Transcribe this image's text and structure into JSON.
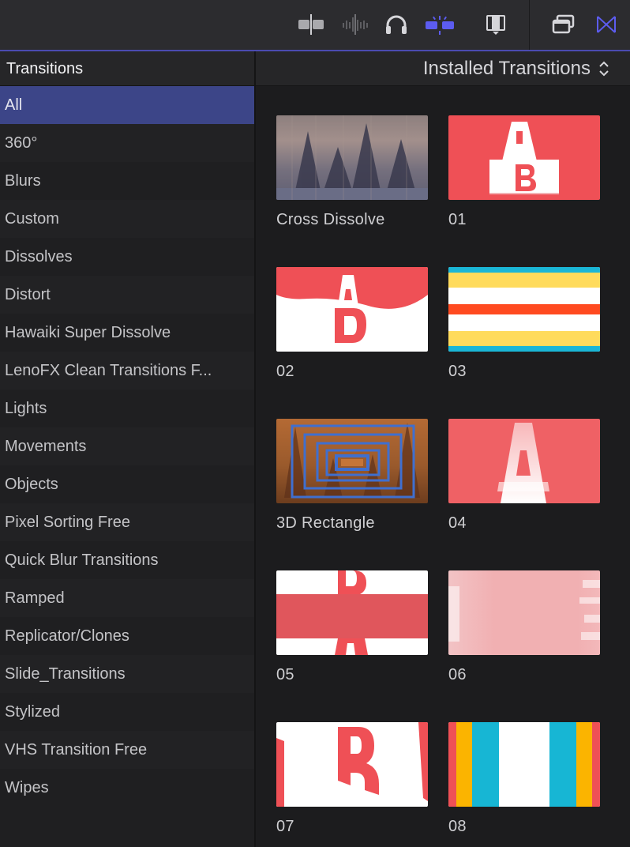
{
  "toolbar": {
    "icons": [
      "clip-skimming-icon",
      "audio-skimming-icon",
      "headphones-solo-icon",
      "snapping-icon",
      "video-browser-icon",
      "window-layout-icon",
      "transitions-browser-icon"
    ],
    "accent_color": "#5c5cf0"
  },
  "sidebar": {
    "title": "Transitions",
    "items": [
      {
        "label": "All",
        "selected": true
      },
      {
        "label": "360°"
      },
      {
        "label": "Blurs"
      },
      {
        "label": "Custom"
      },
      {
        "label": "Dissolves"
      },
      {
        "label": "Distort"
      },
      {
        "label": "Hawaiki Super Dissolve"
      },
      {
        "label": "LenoFX Clean Transitions F..."
      },
      {
        "label": "Lights"
      },
      {
        "label": "Movements"
      },
      {
        "label": "Objects"
      },
      {
        "label": "Pixel Sorting Free"
      },
      {
        "label": "Quick Blur Transitions"
      },
      {
        "label": "Ramped"
      },
      {
        "label": "Replicator/Clones"
      },
      {
        "label": "Slide_Transitions"
      },
      {
        "label": "Stylized"
      },
      {
        "label": "VHS Transition Free"
      },
      {
        "label": "Wipes"
      }
    ]
  },
  "main": {
    "dropdown_label": "Installed Transitions",
    "tiles": [
      {
        "label": "Cross Dissolve",
        "thumb": "cross-dissolve-thumbnail"
      },
      {
        "label": "01",
        "thumb": "transition-01-thumbnail"
      },
      {
        "label": "02",
        "thumb": "transition-02-thumbnail"
      },
      {
        "label": "03",
        "thumb": "transition-03-thumbnail"
      },
      {
        "label": "3D Rectangle",
        "thumb": "3d-rectangle-thumbnail"
      },
      {
        "label": "04",
        "thumb": "transition-04-thumbnail"
      },
      {
        "label": "05",
        "thumb": "transition-05-thumbnail"
      },
      {
        "label": "06",
        "thumb": "transition-06-thumbnail"
      },
      {
        "label": "07",
        "thumb": "transition-07-thumbnail"
      },
      {
        "label": "08",
        "thumb": "transition-08-thumbnail"
      }
    ]
  }
}
